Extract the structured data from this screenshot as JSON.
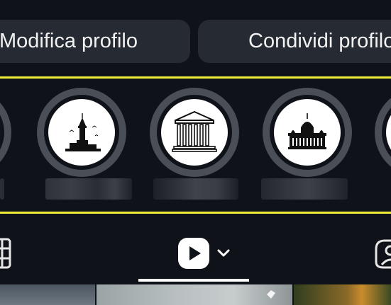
{
  "buttons": {
    "edit_profile": "Modifica profilo",
    "share_profile": "Condividi profilo"
  },
  "highlights": [
    {
      "icon": "circle-partial",
      "caption": ""
    },
    {
      "icon": "maidens-tower-icon",
      "caption": ""
    },
    {
      "icon": "parthenon-icon",
      "caption": ""
    },
    {
      "icon": "cathedral-icon",
      "caption": ""
    },
    {
      "icon": "circle-partial",
      "caption": ""
    }
  ],
  "tabs": [
    {
      "name": "grid",
      "icon": "grid-icon"
    },
    {
      "name": "reels",
      "icon": "reels-play-icon",
      "selected": true
    },
    {
      "name": "tagged",
      "icon": "tagged-person-icon"
    }
  ],
  "colors": {
    "background": "#0f1218",
    "button": "#262a33",
    "highlight_frame": "#f1ef3a",
    "ring": "#4a4e57"
  }
}
